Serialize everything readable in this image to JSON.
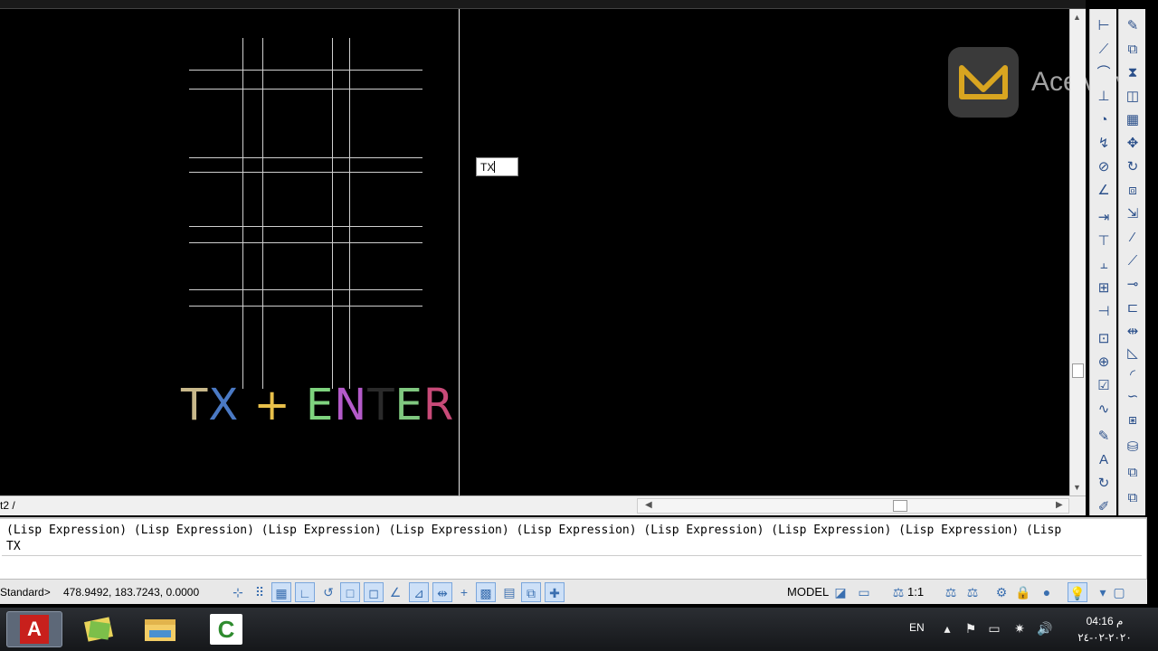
{
  "watermark": {
    "text": "AceMovi"
  },
  "canvas": {
    "dynamic_input_value": "TX",
    "overlay_text": [
      {
        "text": "T",
        "color": "#c8b88a"
      },
      {
        "text": "X",
        "color": "#4a79c4"
      },
      {
        "text": " + ",
        "color": "#e8c04a"
      },
      {
        "text": "E",
        "color": "#7ed37e"
      },
      {
        "text": "N",
        "color": "#b45ac9"
      },
      {
        "text": "T",
        "color": "#2a2a2a"
      },
      {
        "text": "E",
        "color": "#7fc77f"
      },
      {
        "text": "R",
        "color": "#c84a78"
      }
    ]
  },
  "layout_tab": {
    "label": "t2 /"
  },
  "command_line": {
    "history": "(Lisp Expression) (Lisp Expression) (Lisp Expression) (Lisp Expression) (Lisp Expression) (Lisp Expression) (Lisp Expression) (Lisp Expression) (Lisp",
    "last_command": "TX",
    "input_value": ""
  },
  "status_bar": {
    "text_style": "Standard>",
    "coordinates": "478.9492, 183.7243, 0.0000",
    "space": "MODEL",
    "annotation_scale": "1:1"
  },
  "taskbar": {
    "apps": [
      "autocad-icon",
      "apps-icon",
      "file-explorer-icon",
      "camtasia-icon"
    ],
    "language": "EN",
    "time": "04:16 م",
    "date": "٢٠٢٠-٠٢-٢٤"
  },
  "colors": {
    "canvas_bg": "#000000",
    "grid_lines": "#cfcfcf",
    "accent": "#3a6fb0"
  }
}
